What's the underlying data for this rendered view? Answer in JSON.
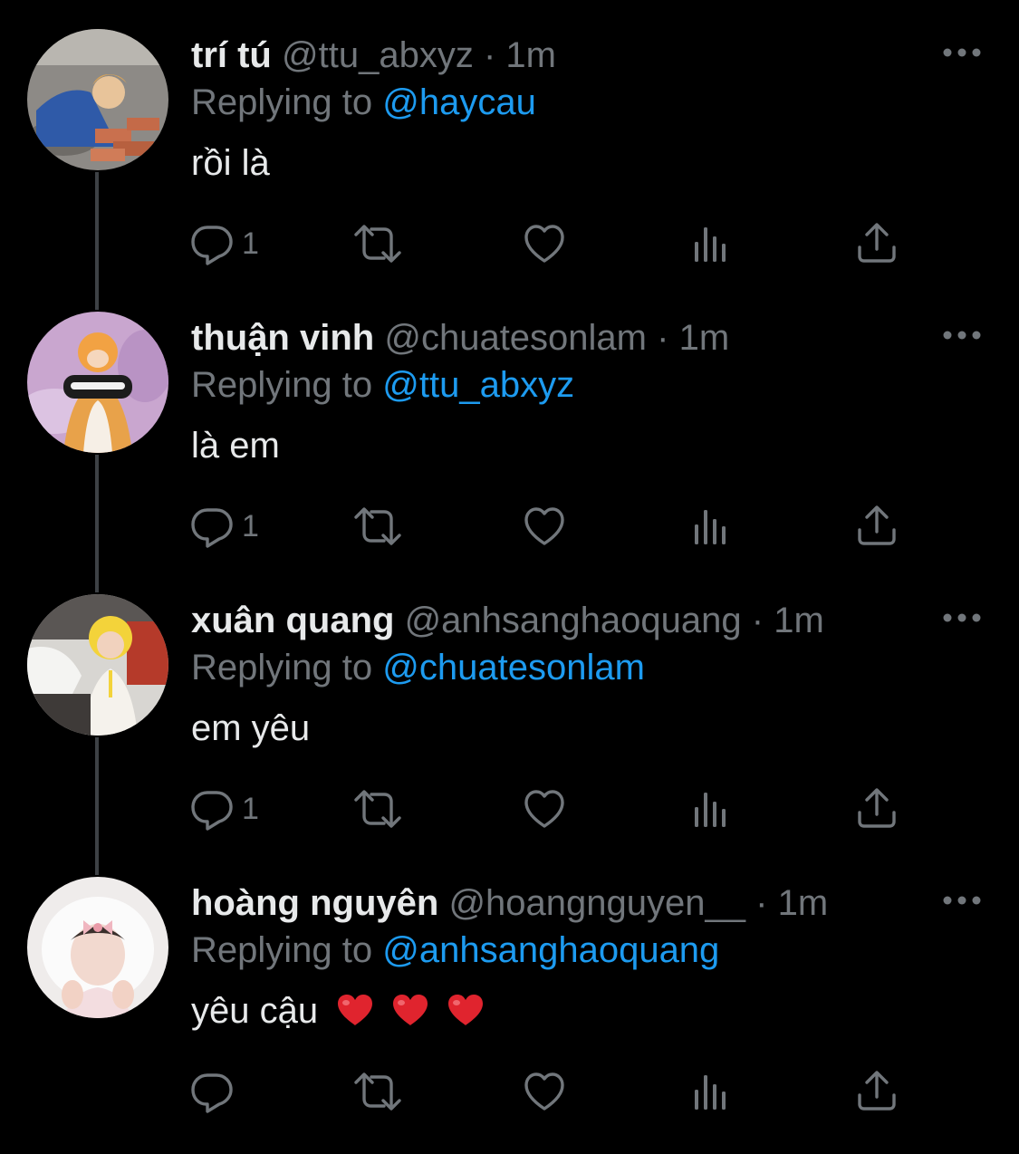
{
  "colors": {
    "background": "#000000",
    "primary_text": "#e7e9ea",
    "secondary_text": "#71767b",
    "link": "#1d9bf0",
    "thread_line": "#3d4145",
    "emoji_heart": "#e0242e"
  },
  "replying_prefix": "Replying to",
  "tweets": [
    {
      "display_name": "trí tú",
      "handle": "@ttu_abxyz",
      "separator": "·",
      "time": "1m",
      "reply_to": "@haycau",
      "text": "rồi là",
      "heart_emojis": 0,
      "reply_count": "1",
      "more_icon": "ellipsis-icon"
    },
    {
      "display_name": "thuận vinh",
      "handle": "@chuatesonlam",
      "separator": "·",
      "time": "1m",
      "reply_to": "@ttu_abxyz",
      "text": "là em",
      "heart_emojis": 0,
      "reply_count": "1",
      "more_icon": "ellipsis-icon"
    },
    {
      "display_name": "xuân quang",
      "handle": "@anhsanghaoquang",
      "separator": "·",
      "time": "1m",
      "reply_to": "@chuatesonlam",
      "text": "em yêu",
      "heart_emojis": 0,
      "reply_count": "1",
      "more_icon": "ellipsis-icon"
    },
    {
      "display_name": "hoàng nguyên",
      "handle": "@hoangnguyen__",
      "separator": "·",
      "time": "1m",
      "reply_to": "@anhsanghaoquang",
      "text": "yêu cậu",
      "heart_emojis": 3,
      "reply_count": "",
      "more_icon": "ellipsis-icon"
    }
  ]
}
